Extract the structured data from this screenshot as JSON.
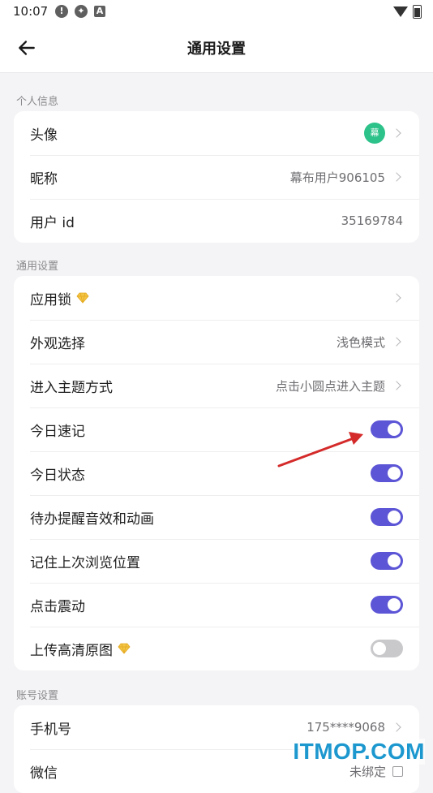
{
  "status_bar": {
    "time": "10:07",
    "icons": [
      "alert-icon",
      "sync-icon",
      "a-square-icon",
      "wifi-icon",
      "battery-icon"
    ]
  },
  "header": {
    "title": "通用设置",
    "back_icon": "arrow-left-icon"
  },
  "sections": {
    "personal": {
      "label": "个人信息",
      "rows": {
        "avatar": {
          "label": "头像",
          "avatar_text": "幕"
        },
        "nickname": {
          "label": "昵称",
          "value": "幕布用户906105"
        },
        "user_id": {
          "label": "用户 id",
          "value": "35169784"
        }
      }
    },
    "general": {
      "label": "通用设置",
      "rows": {
        "app_lock": {
          "label": "应用锁"
        },
        "appearance": {
          "label": "外观选择",
          "value": "浅色模式"
        },
        "theme_entry": {
          "label": "进入主题方式",
          "value": "点击小圆点进入主题"
        },
        "today_note": {
          "label": "今日速记",
          "enabled": true
        },
        "today_status": {
          "label": "今日状态",
          "enabled": true
        },
        "todo_effects": {
          "label": "待办提醒音效和动画",
          "enabled": true
        },
        "remember_position": {
          "label": "记住上次浏览位置",
          "enabled": true
        },
        "click_vibrate": {
          "label": "点击震动",
          "enabled": true
        },
        "upload_hd": {
          "label": "上传高清原图",
          "enabled": false
        }
      }
    },
    "account": {
      "label": "账号设置",
      "rows": {
        "phone": {
          "label": "手机号",
          "value": "175****9068"
        },
        "wechat": {
          "label": "微信",
          "value": "未绑定"
        }
      }
    }
  },
  "watermark": "ITMOP.COM",
  "colors": {
    "accent": "#5c55d6",
    "avatar_bg": "#2cc28a",
    "gem": "#f3c545",
    "annotation_arrow": "#d42a2a",
    "watermark": "#1d98cf"
  }
}
